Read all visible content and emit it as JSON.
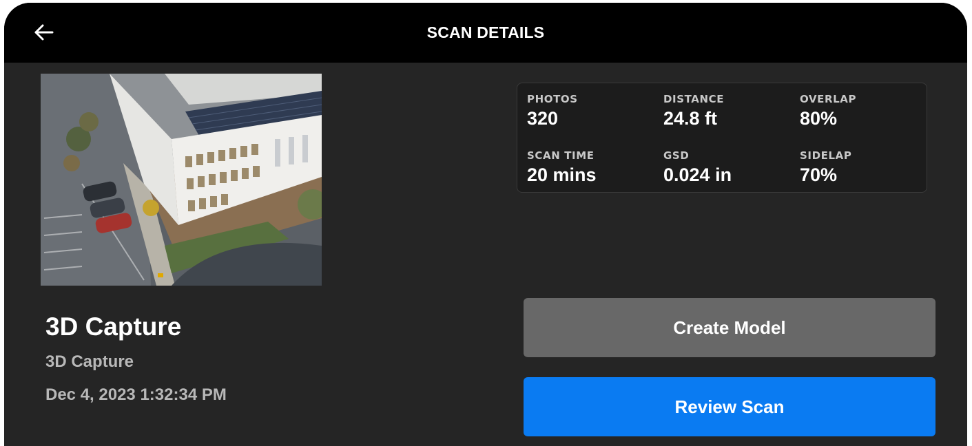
{
  "header": {
    "title": "SCAN DETAILS",
    "back_icon": "arrow-left-icon"
  },
  "scan": {
    "title": "3D Capture",
    "subtitle": "3D Capture",
    "date": "Dec 4, 2023 1:32:34 PM",
    "thumbnail": "aerial-building-photo"
  },
  "stats": {
    "photos": {
      "label": "PHOTOS",
      "value": "320"
    },
    "distance": {
      "label": "DISTANCE",
      "value": "24.8 ft"
    },
    "overlap": {
      "label": "OVERLAP",
      "value": "80%"
    },
    "scan_time": {
      "label": "SCAN TIME",
      "value": "20 mins"
    },
    "gsd": {
      "label": "GSD",
      "value": "0.024 in"
    },
    "sidelap": {
      "label": "SIDELAP",
      "value": "70%"
    }
  },
  "actions": {
    "create_model_label": "Create Model",
    "review_scan_label": "Review Scan"
  },
  "colors": {
    "background": "#252525",
    "header": "#000000",
    "primary_button": "#0a7bf2",
    "secondary_button": "#686868"
  }
}
